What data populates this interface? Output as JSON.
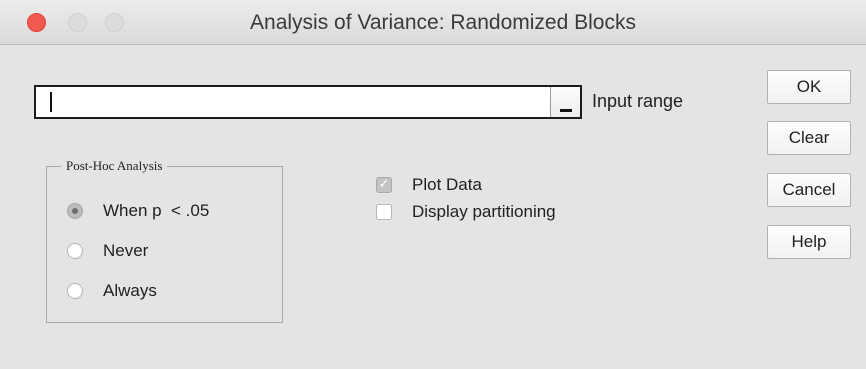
{
  "window": {
    "title": "Analysis of Variance: Randomized Blocks"
  },
  "input": {
    "value": "",
    "label": "Input range"
  },
  "posthoc": {
    "legend": "Post-Hoc Analysis",
    "options": [
      {
        "label": "When p  < .05",
        "selected": true
      },
      {
        "label": "Never",
        "selected": false
      },
      {
        "label": "Always",
        "selected": false
      }
    ]
  },
  "options": {
    "plot_data": {
      "label": "Plot Data",
      "checked": true
    },
    "display_partitioning": {
      "label": "Display partitioning",
      "checked": false
    }
  },
  "buttons": {
    "ok": "OK",
    "clear": "Clear",
    "cancel": "Cancel",
    "help": "Help"
  },
  "colors": {
    "close": "#f0594f",
    "background": "#e4e4e4"
  }
}
